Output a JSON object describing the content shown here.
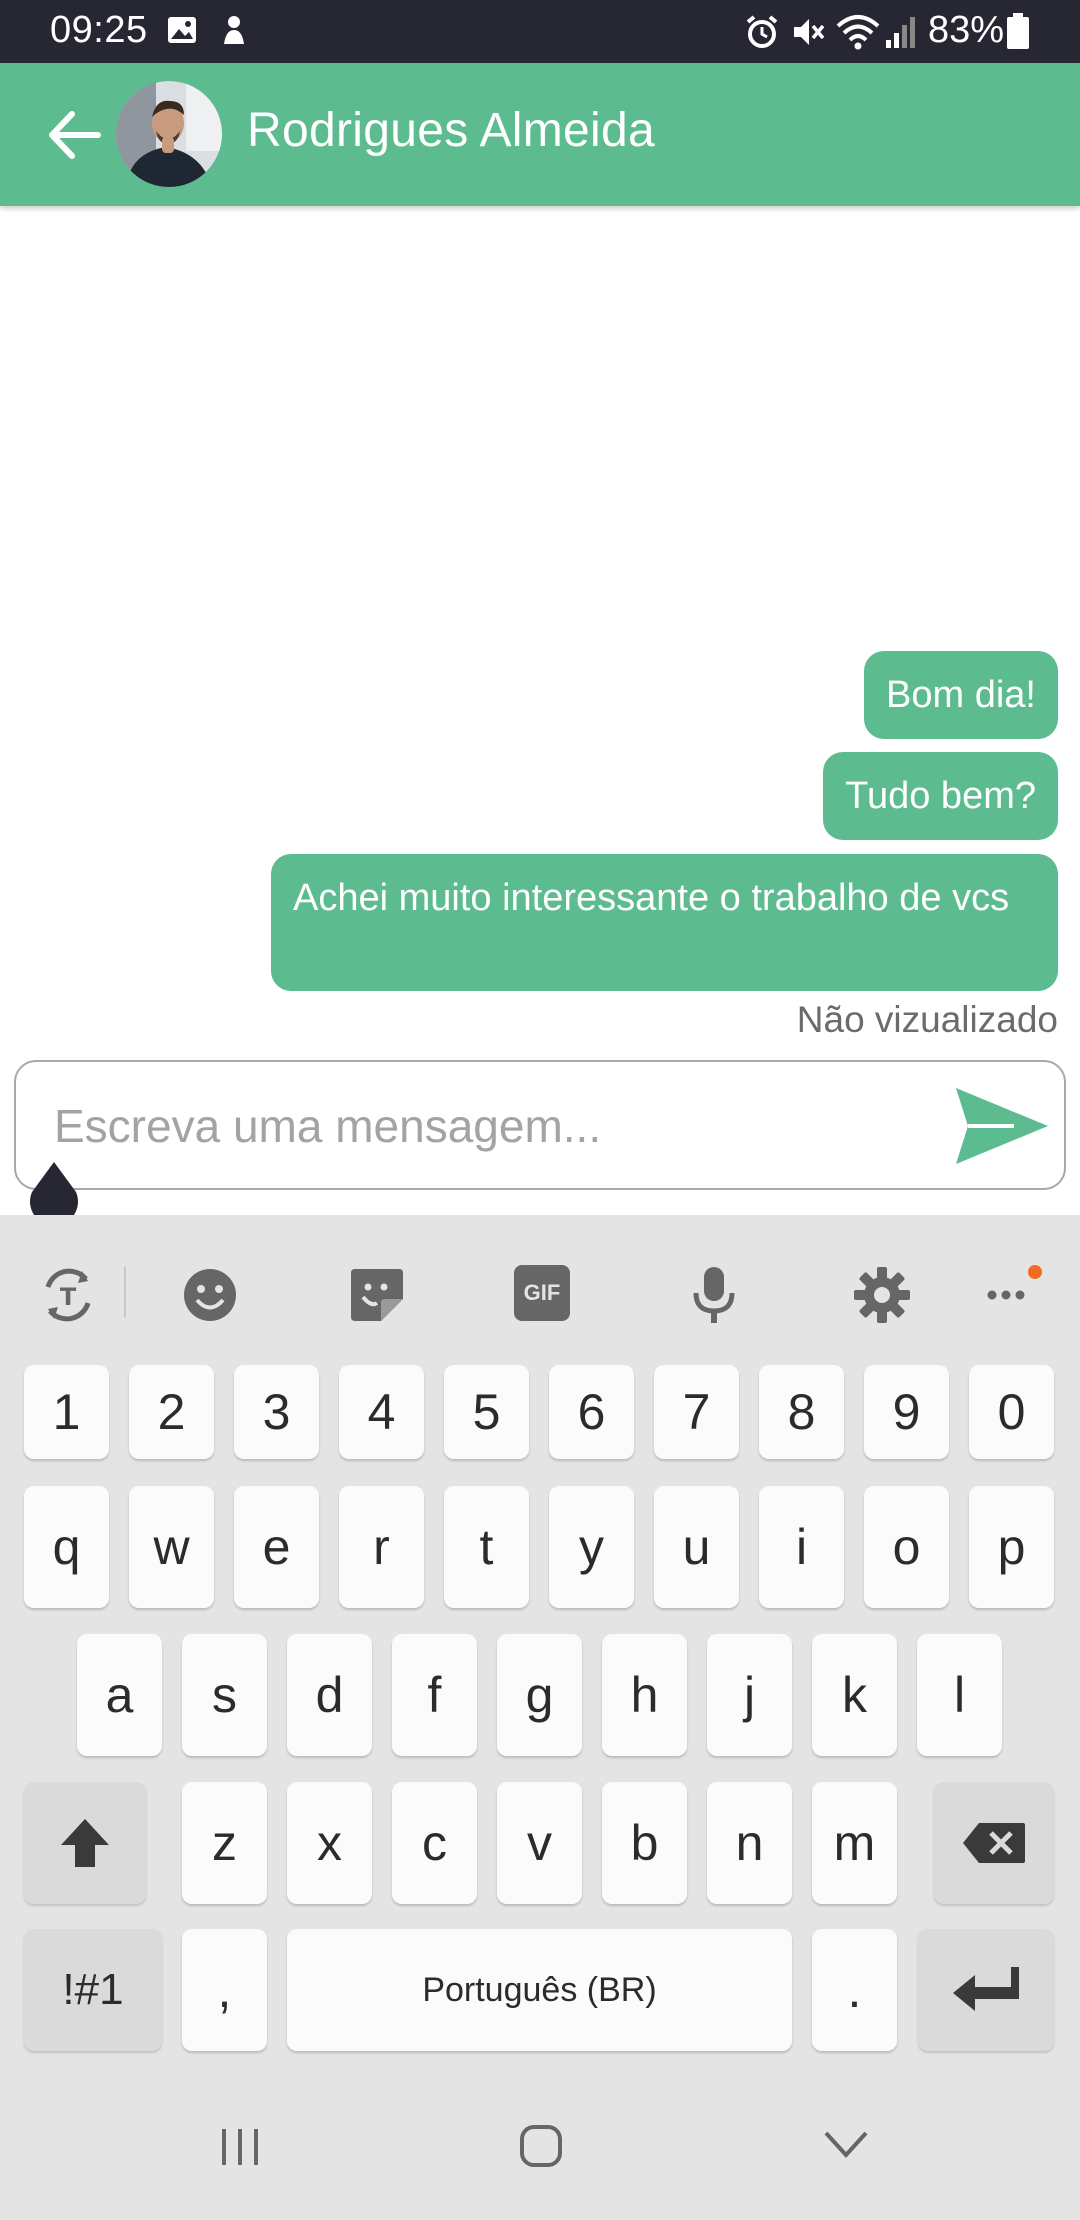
{
  "status_bar": {
    "time": "09:25",
    "battery": "83%",
    "icons": [
      "image-icon",
      "notification-icon",
      "alarm-icon",
      "mute-icon",
      "wifi-icon",
      "signal-icon",
      "battery-icon"
    ]
  },
  "header": {
    "contact_name": "Rodrigues Almeida",
    "back_icon": "arrow-left-icon",
    "accent_color": "#5dbc8f"
  },
  "messages": [
    {
      "text": "Bom dia!",
      "outgoing": true
    },
    {
      "text": "Tudo bem?",
      "outgoing": true
    },
    {
      "text": "Achei muito interessante o trabalho de vcs",
      "outgoing": true
    }
  ],
  "read_status": "Não vizualizado",
  "composer": {
    "placeholder": "Escreva uma mensagem...",
    "value": "",
    "send_icon": "send-icon"
  },
  "keyboard": {
    "toolbar": [
      "text-translate-icon",
      "emoji-icon",
      "sticker-icon",
      "gif-icon",
      "microphone-icon",
      "settings-icon",
      "more-icon"
    ],
    "gif_label": "GIF",
    "number_row": [
      "1",
      "2",
      "3",
      "4",
      "5",
      "6",
      "7",
      "8",
      "9",
      "0"
    ],
    "row1": [
      "q",
      "w",
      "e",
      "r",
      "t",
      "y",
      "u",
      "i",
      "o",
      "p"
    ],
    "row2": [
      "a",
      "s",
      "d",
      "f",
      "g",
      "h",
      "j",
      "k",
      "l"
    ],
    "row3": [
      "z",
      "x",
      "c",
      "v",
      "b",
      "n",
      "m"
    ],
    "symbols_label": "!#1",
    "comma": ",",
    "space_label": "Português (BR)",
    "period": "."
  },
  "nav_bar": [
    "recent-apps-icon",
    "home-icon",
    "back-chevron-icon"
  ]
}
